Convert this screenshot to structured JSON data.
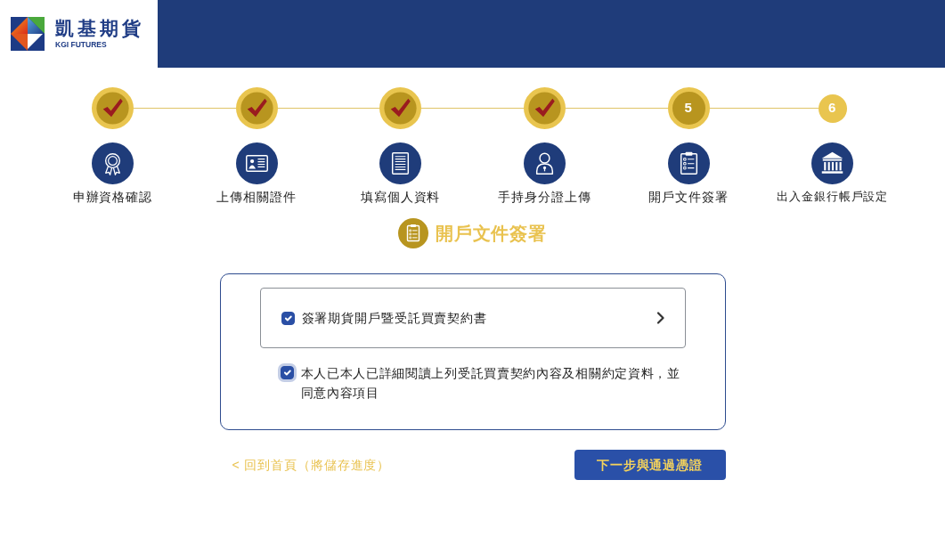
{
  "header": {
    "logo_title": "凱基期貨",
    "logo_subtitle": "KGI FUTURES"
  },
  "steps": [
    {
      "label": "申辦資格確認",
      "completed": true
    },
    {
      "label": "上傳相關證件",
      "completed": true
    },
    {
      "label": "填寫個人資料",
      "completed": true
    },
    {
      "label": "手持身分證上傳",
      "completed": true
    },
    {
      "number": "5",
      "label": "開戶文件簽署",
      "completed": false,
      "current": true
    },
    {
      "number": "6",
      "label": "出入金銀行帳戶設定",
      "completed": false,
      "current": false
    }
  ],
  "section_title": "開戶文件簽署",
  "documents": [
    {
      "label": "簽署期貨開戶暨受託買賣契約書",
      "checked": true
    }
  ],
  "agreement": {
    "text": "本人已本人已詳細閱讀上列受託買賣契約內容及相關約定資料，並同意內容項目",
    "checked": true,
    "focused": true
  },
  "footer": {
    "back_link": "< 回到首頁（將儲存進度）",
    "next_button": "下一步與通過憑證"
  }
}
